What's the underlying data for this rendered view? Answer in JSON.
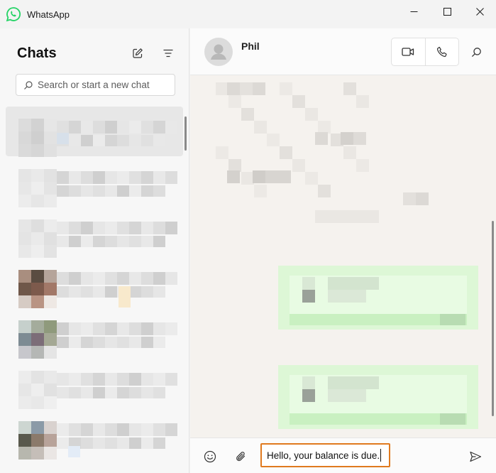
{
  "window": {
    "title": "WhatsApp",
    "brand_color": "#25d366"
  },
  "sidebar": {
    "title": "Chats",
    "search": {
      "placeholder": "Search or start a new chat",
      "value": ""
    },
    "chat_count": 7
  },
  "conversation": {
    "contact_name": "Phil",
    "composer": {
      "value": "Hello, your balance is due.",
      "focus_color": "#e07a1f"
    }
  },
  "icons": [
    "whatsapp-logo-icon",
    "minimize-icon",
    "maximize-icon",
    "close-icon",
    "new-chat-icon",
    "filter-icon",
    "search-icon",
    "avatar-icon",
    "video-call-icon",
    "voice-call-icon",
    "emoji-icon",
    "attach-icon",
    "send-icon"
  ]
}
